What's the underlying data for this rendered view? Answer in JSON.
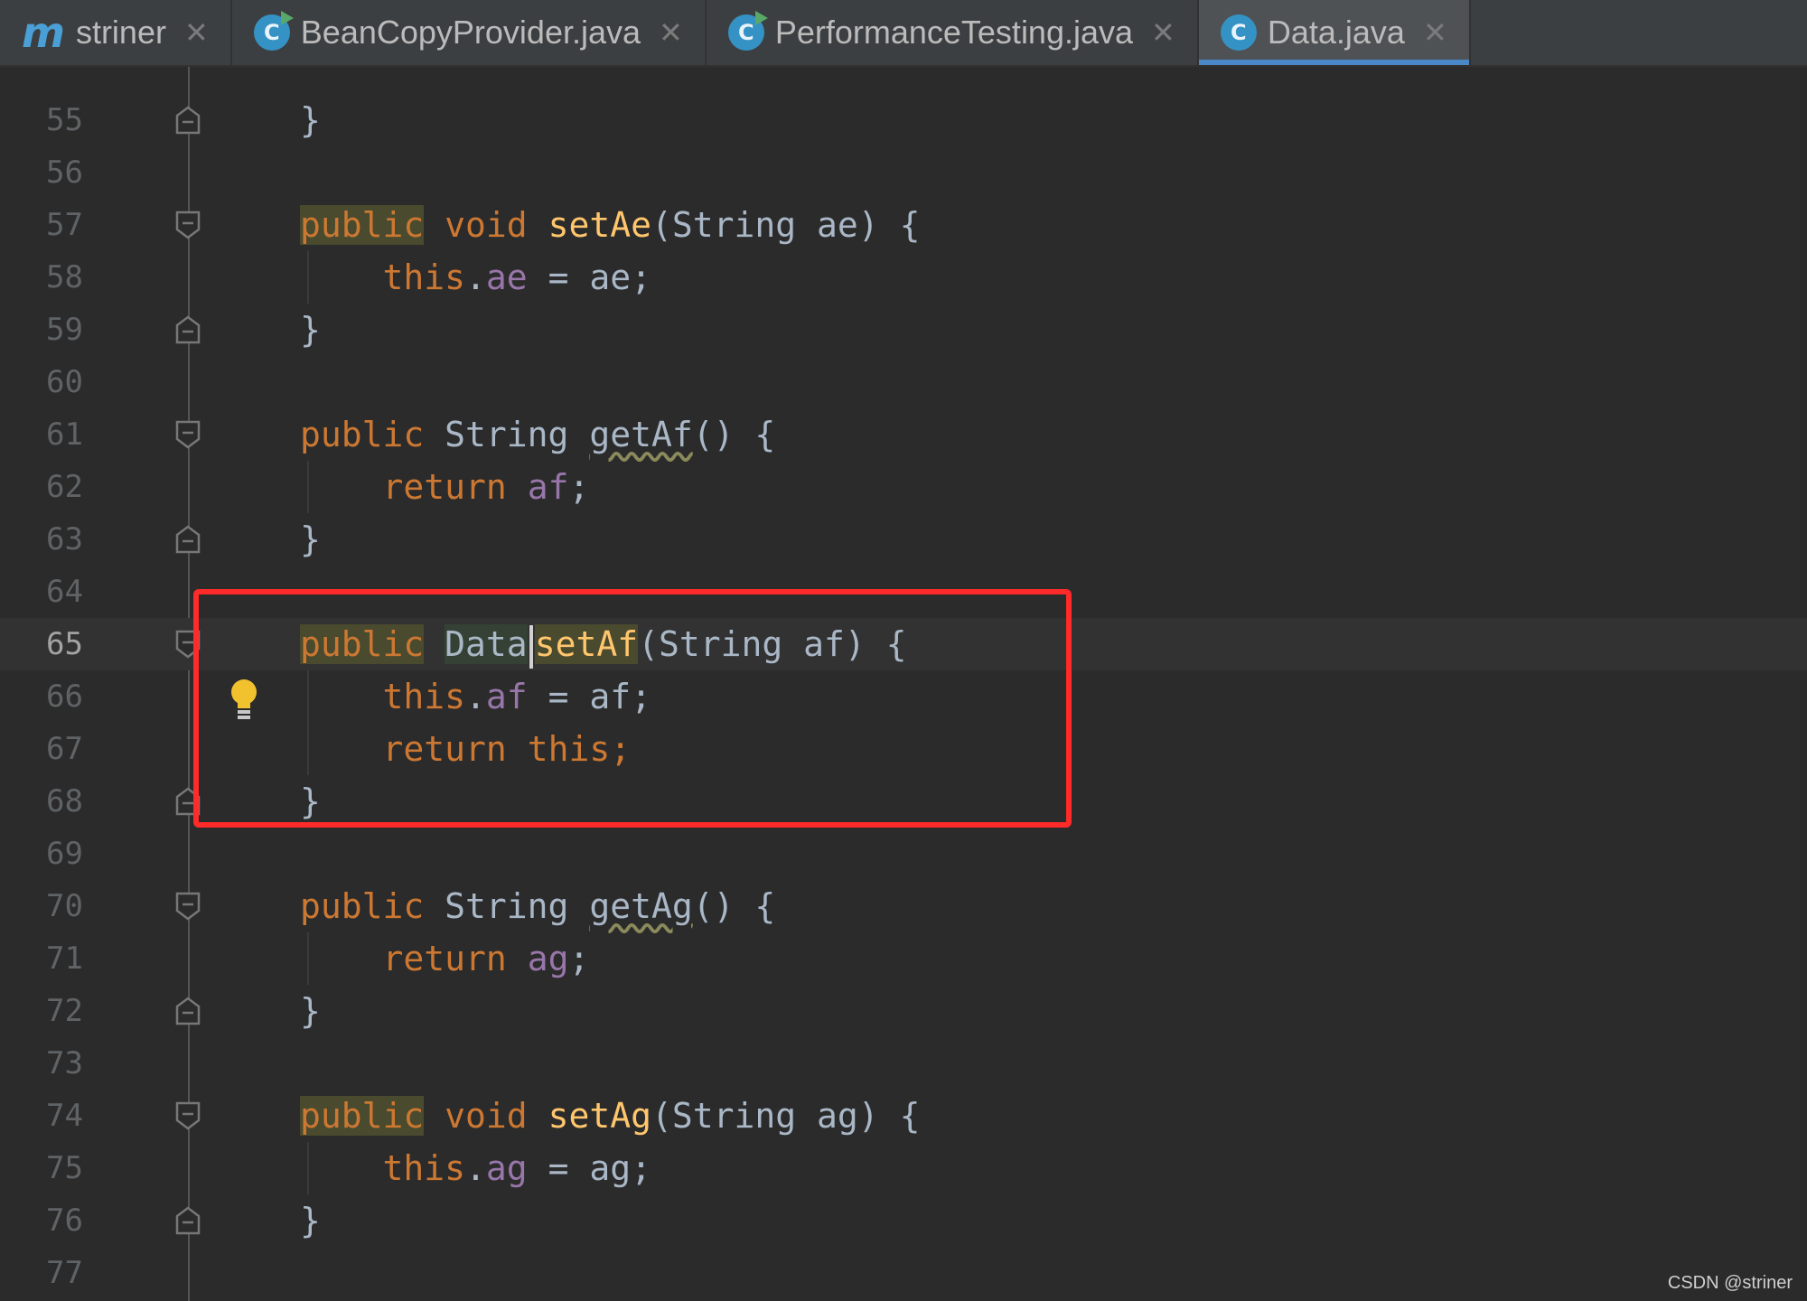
{
  "tabs": [
    {
      "label": "striner",
      "icon": "module-m-icon",
      "active": false
    },
    {
      "label": "BeanCopyProvider.java",
      "icon": "java-class-runnable-icon",
      "active": false
    },
    {
      "label": "PerformanceTesting.java",
      "icon": "java-class-runnable-icon",
      "active": false
    },
    {
      "label": "Data.java",
      "icon": "java-class-icon",
      "active": true
    }
  ],
  "colors": {
    "background": "#2b2b2b",
    "keyword": "#cc7832",
    "method": "#ffc66d",
    "field": "#9876aa",
    "text": "#a9b7c6",
    "highlight_box": "#ff2a2a",
    "tab_accent": "#4a88c7"
  },
  "editor": {
    "current_line": "65",
    "highlighted_method": "setAf",
    "lines": [
      {
        "no": "55",
        "text": "}"
      },
      {
        "no": "56",
        "text": ""
      },
      {
        "no": "57",
        "text": "public void setAe(String ae) {"
      },
      {
        "no": "58",
        "text": "this.ae = ae;"
      },
      {
        "no": "59",
        "text": "}"
      },
      {
        "no": "60",
        "text": ""
      },
      {
        "no": "61",
        "text": "public String getAf() {"
      },
      {
        "no": "62",
        "text": "return af;"
      },
      {
        "no": "63",
        "text": "}"
      },
      {
        "no": "64",
        "text": ""
      },
      {
        "no": "65",
        "text": "public Data setAf(String af) {"
      },
      {
        "no": "66",
        "text": "this.af = af;"
      },
      {
        "no": "67",
        "text": "return this;"
      },
      {
        "no": "68",
        "text": "}"
      },
      {
        "no": "69",
        "text": ""
      },
      {
        "no": "70",
        "text": "public String getAg() {"
      },
      {
        "no": "71",
        "text": "return ag;"
      },
      {
        "no": "72",
        "text": "}"
      },
      {
        "no": "73",
        "text": ""
      },
      {
        "no": "74",
        "text": "public void setAg(String ag) {"
      },
      {
        "no": "75",
        "text": "this.ag = ag;"
      },
      {
        "no": "76",
        "text": "}"
      },
      {
        "no": "77",
        "text": ""
      }
    ],
    "tokens": {
      "brace_close": "}",
      "brace_open": "{",
      "kw_public": "public",
      "kw_void": "void",
      "kw_return": "return",
      "kw_this": "this",
      "type_string": "String",
      "type_data": "Data",
      "m_setAe": "setAe",
      "m_getAf": "getAf",
      "m_setAf": "setAf",
      "m_getAg": "getAg",
      "m_setAg": "setAg",
      "v_ae": "ae",
      "v_af": "af",
      "v_ag": "ag"
    }
  },
  "watermark": "CSDN @striner"
}
